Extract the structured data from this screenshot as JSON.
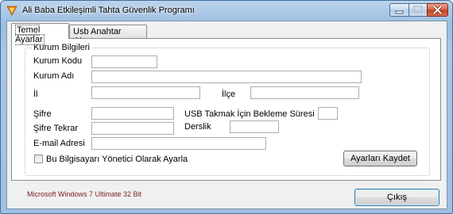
{
  "window": {
    "title": "Ali Baba Etkileşimli Tahta Güvenlik Programı",
    "icon": "app-logo-icon"
  },
  "tabs": [
    {
      "label": "Temel Ayarlar",
      "active": true
    },
    {
      "label": "Usb Anahtar Oluştur",
      "active": false
    }
  ],
  "group": {
    "title": "Kurum Bilgileri"
  },
  "form": {
    "kurum_kodu_label": "Kurum Kodu",
    "kurum_kodu_value": "",
    "kurum_adi_label": "Kurum Adı",
    "kurum_adi_value": "",
    "il_label": "İl",
    "il_value": "",
    "ilce_label": "İlçe",
    "ilce_value": "",
    "sifre_label": "Şifre",
    "sifre_value": "",
    "usb_wait_label": "USB Takmak İçin Bekleme Süresi",
    "usb_wait_value": "",
    "sifre_tekrar_label": "Şifre Tekrar",
    "sifre_tekrar_value": "",
    "derslik_label": "Derslik",
    "derslik_value": "",
    "email_label": "E-mail Adresi",
    "email_value": "",
    "admin_checkbox_label": "Bu Bilgisayarı Yönetici Olarak Ayarla",
    "admin_checked": false,
    "save_button": "Ayarları Kaydet"
  },
  "footer": {
    "os_info": "Microsoft Windows 7 Ultimate  32 Bit",
    "exit_button": "Çıkış"
  },
  "colors": {
    "status_text": "#7b1d1d",
    "title_bar": "#a9c6e6",
    "close_button": "#c23e22"
  }
}
